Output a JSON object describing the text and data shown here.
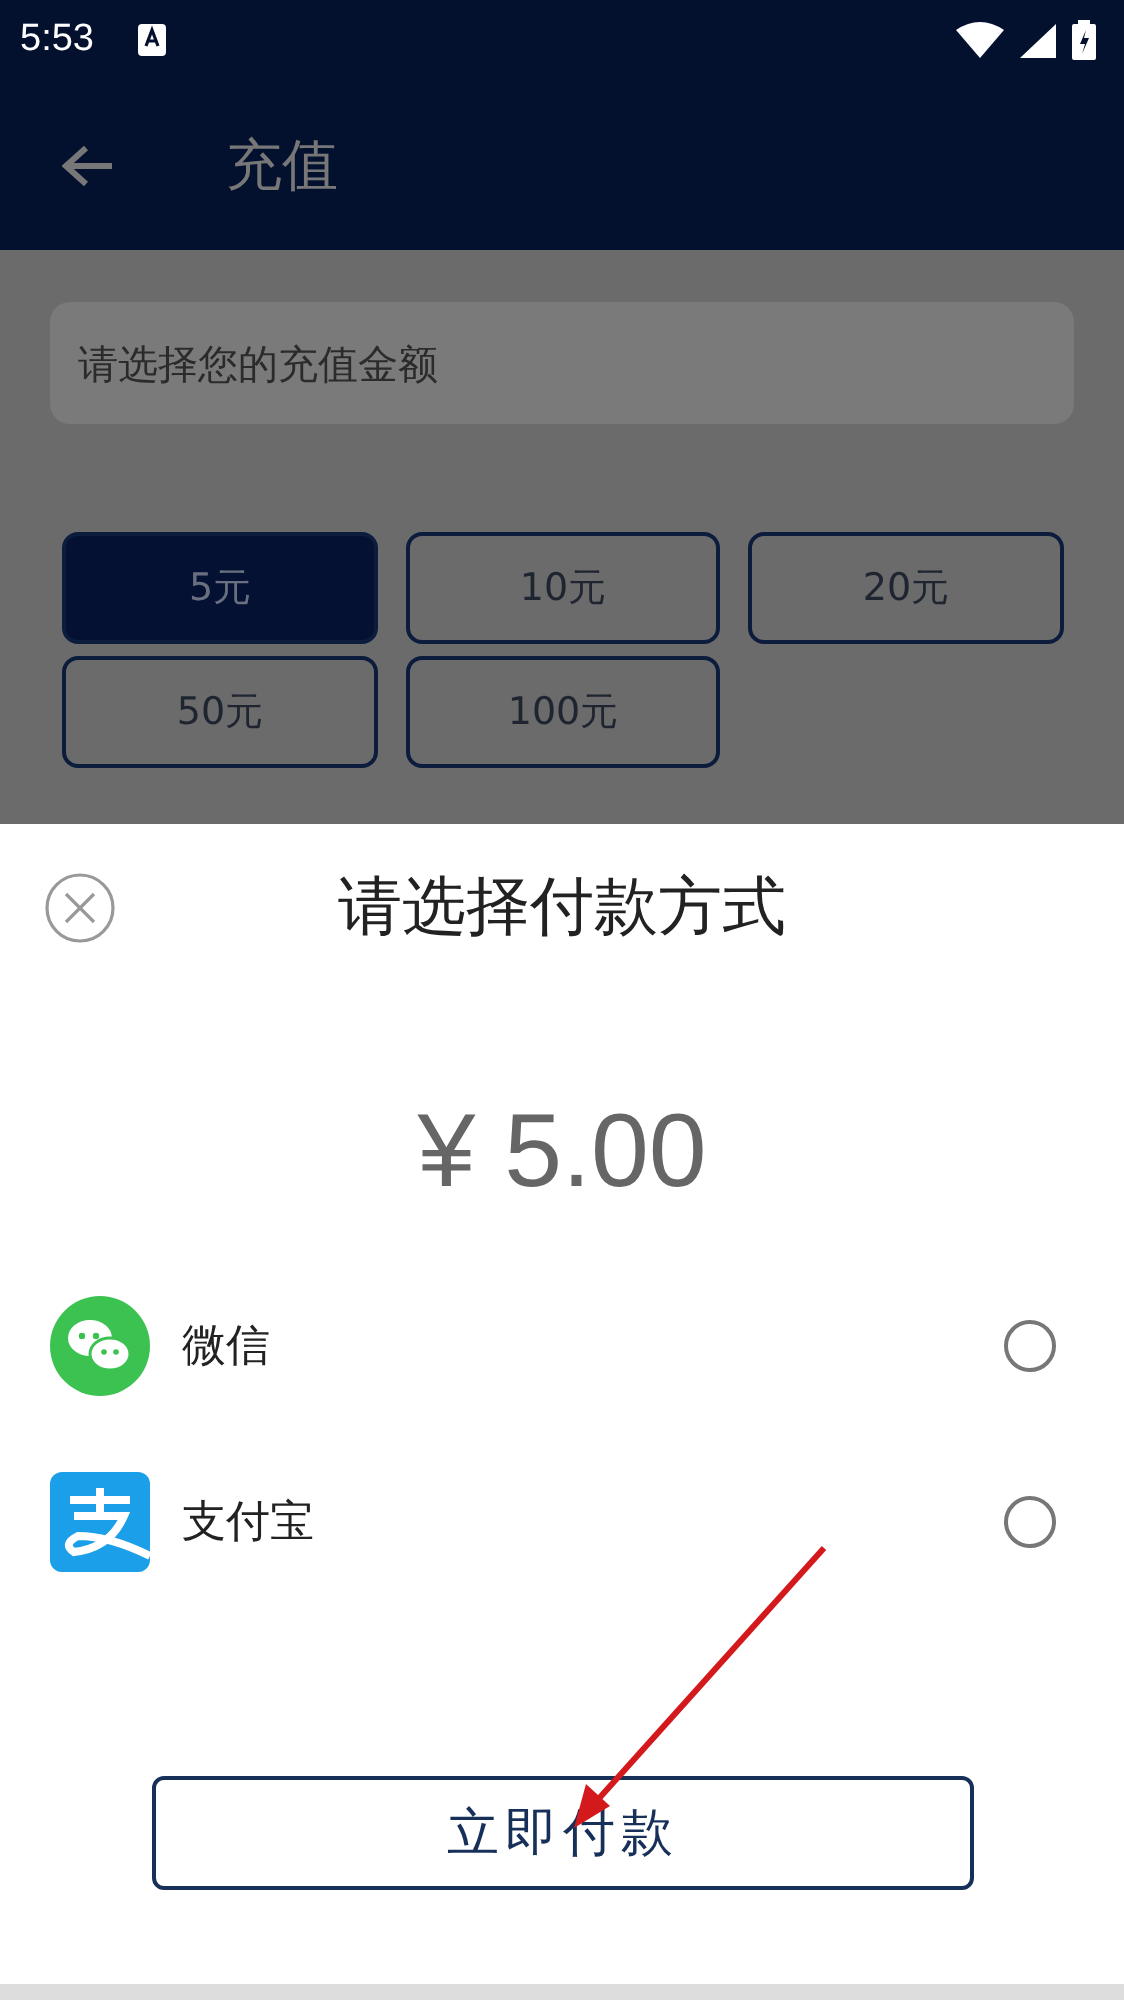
{
  "status_bar": {
    "time": "5:53"
  },
  "app_bar": {
    "title": "充值"
  },
  "amount_field": {
    "placeholder": "请选择您的充值金额"
  },
  "amounts": [
    {
      "label": "5元",
      "selected": true
    },
    {
      "label": "10元",
      "selected": false
    },
    {
      "label": "20元",
      "selected": false
    },
    {
      "label": "50元",
      "selected": false
    },
    {
      "label": "100元",
      "selected": false
    }
  ],
  "payment_sheet": {
    "title": "请选择付款方式",
    "amount": "¥ 5.00",
    "methods": [
      {
        "name": "微信",
        "kind": "wechat",
        "selected": false
      },
      {
        "name": "支付宝",
        "kind": "alipay",
        "selected": false
      }
    ],
    "pay_button": "立即付款"
  }
}
